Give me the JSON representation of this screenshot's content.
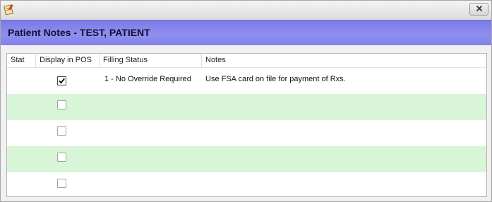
{
  "window": {
    "icon": "notepad-icon",
    "close_icon": "close-icon"
  },
  "header": {
    "title": "Patient Notes - TEST, PATIENT"
  },
  "grid": {
    "columns": [
      "Stat",
      "Display in POS",
      "Filling Status",
      "Notes"
    ],
    "rows": [
      {
        "stat": "",
        "display_in_pos": true,
        "filling_status": "1 - No Override Required",
        "notes": "Use FSA card on file for payment of Rxs."
      },
      {
        "stat": "",
        "display_in_pos": false,
        "filling_status": "",
        "notes": ""
      },
      {
        "stat": "",
        "display_in_pos": false,
        "filling_status": "",
        "notes": ""
      },
      {
        "stat": "",
        "display_in_pos": false,
        "filling_status": "",
        "notes": ""
      },
      {
        "stat": "",
        "display_in_pos": false,
        "filling_status": "",
        "notes": ""
      }
    ],
    "alt_row_color": "#d8f5d8",
    "header_band_color": "#8484ea"
  }
}
